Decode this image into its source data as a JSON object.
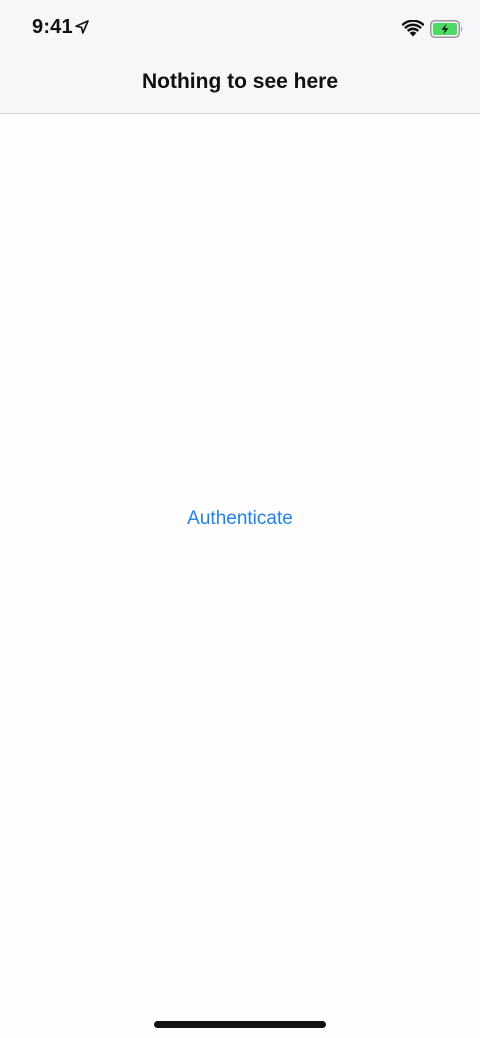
{
  "status_bar": {
    "time": "9:41",
    "icons": [
      "location-arrow-icon",
      "wifi-icon",
      "battery-charging-icon"
    ],
    "battery_color": "#4cd964"
  },
  "nav_bar": {
    "title": "Nothing to see here"
  },
  "main": {
    "authenticate_label": "Authenticate"
  },
  "colors": {
    "accent": "#1f83e6",
    "nav_background": "#f8f6f8",
    "background": "#fffdfe",
    "text": "#111111"
  }
}
